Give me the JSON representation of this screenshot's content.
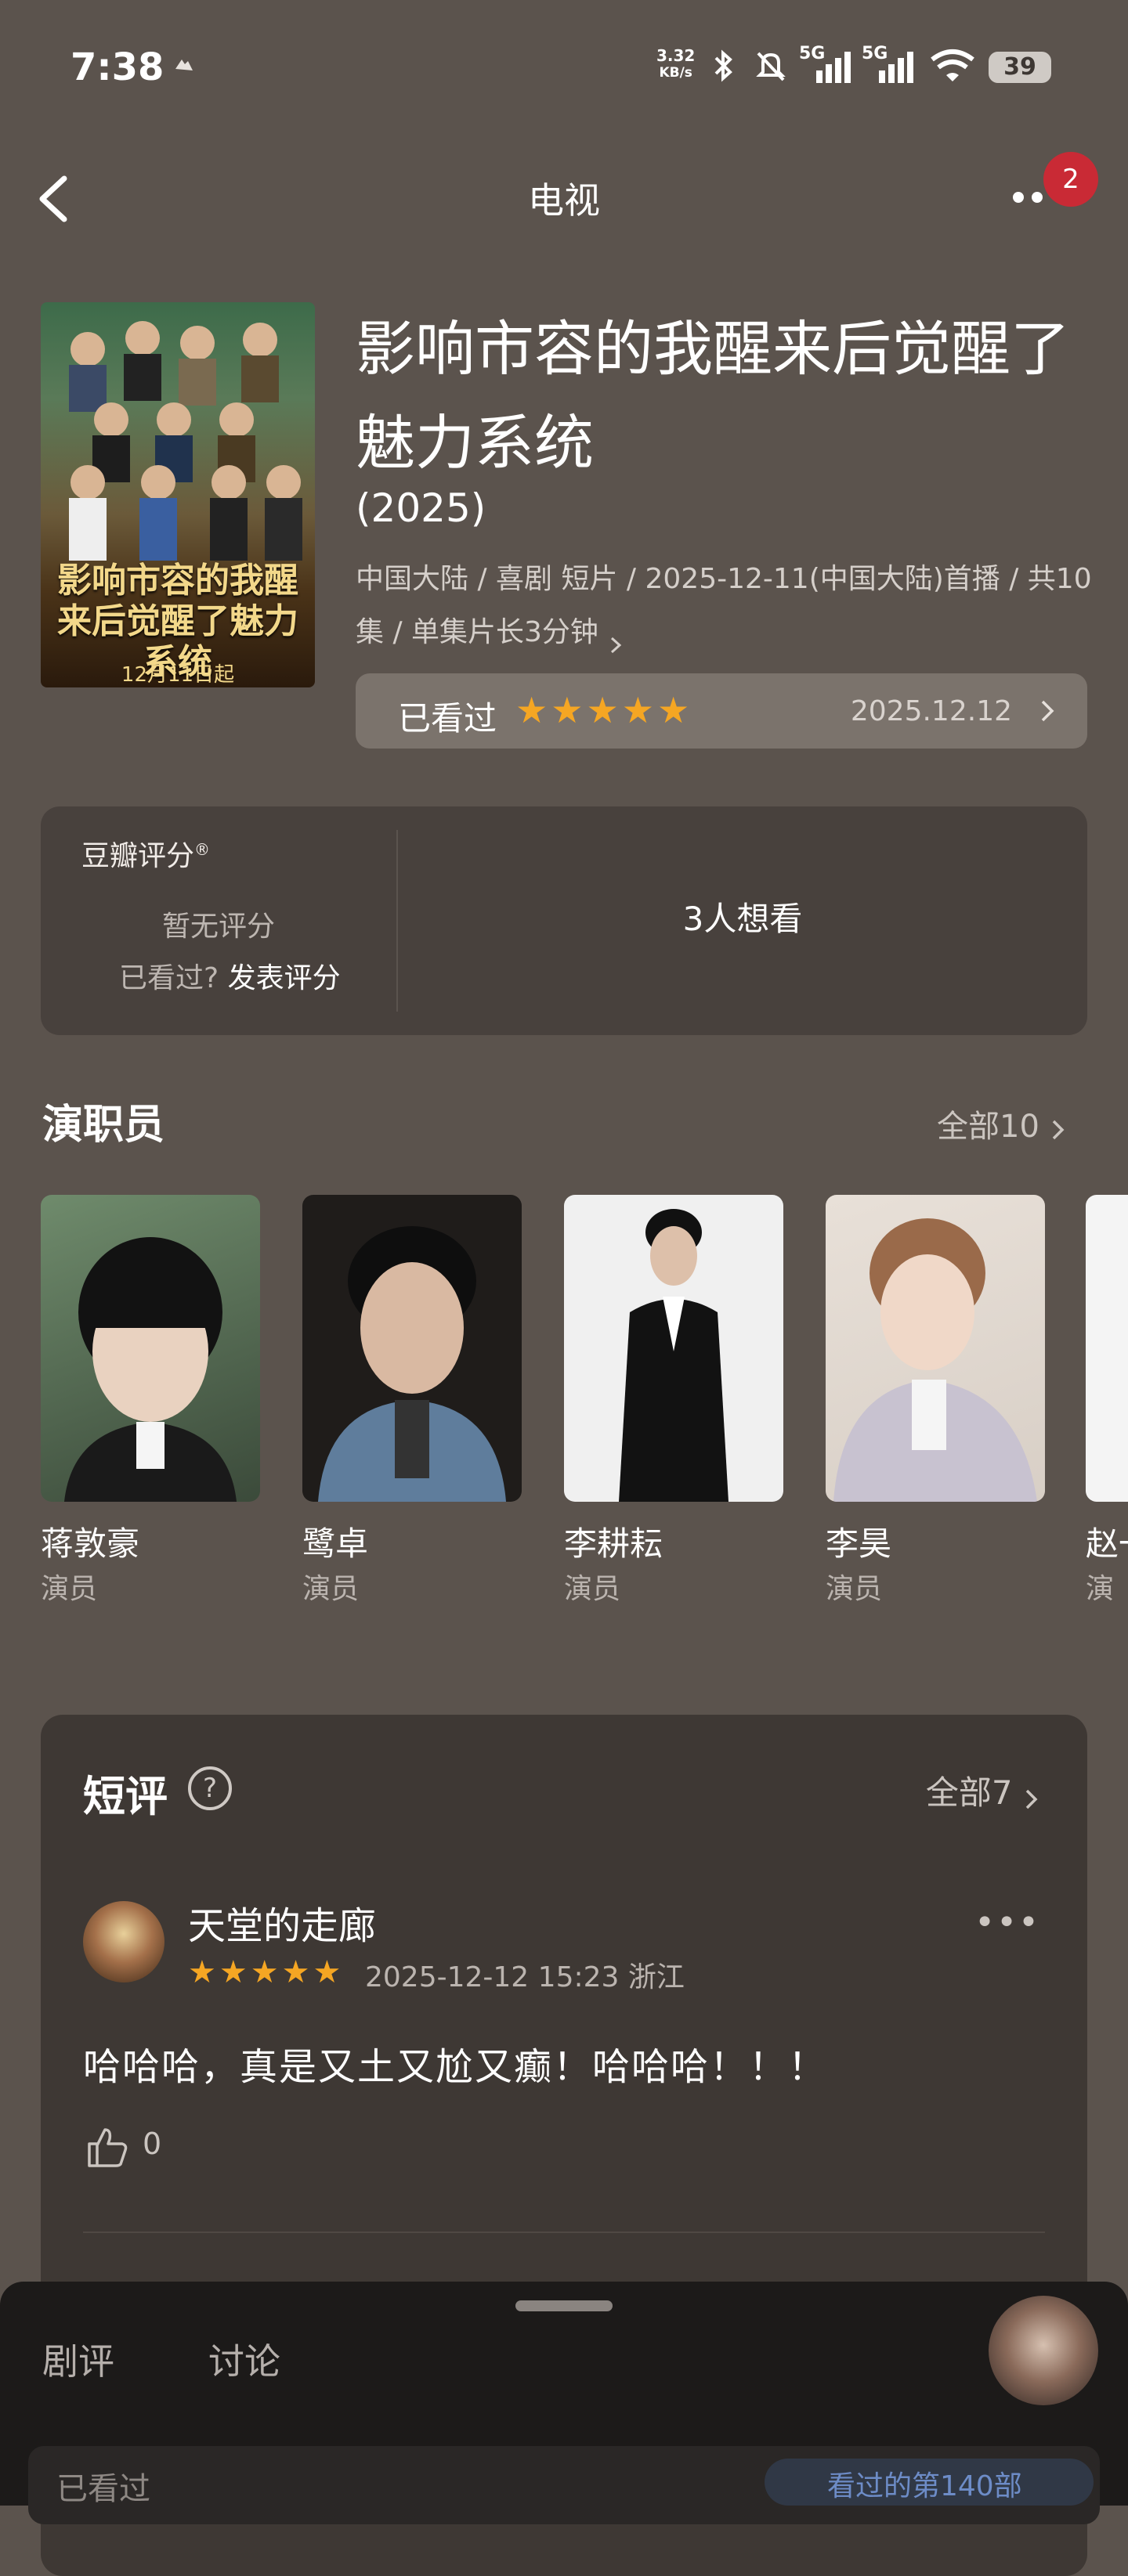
{
  "status_bar": {
    "time": "7:38",
    "net_speed_value": "3.32",
    "net_speed_unit": "KB/s",
    "sim1": "5G",
    "sim2": "5G",
    "battery": "39"
  },
  "header": {
    "title": "电视",
    "badge_count": "2"
  },
  "poster": {
    "title": "影响市容的我醒来后觉醒了魅力系统",
    "date": "12月11日起"
  },
  "work": {
    "title": "影响市容的我醒来后觉醒了魅力系统",
    "year": "(2025)",
    "meta": "中国大陆 / 喜剧 短片 / 2025-12-11(中国大陆)首播 / 共10集 / 单集片长3分钟",
    "watched_label": "已看过",
    "watched_stars": 5,
    "watched_date": "2025.12.12"
  },
  "rating": {
    "title": "豆瓣评分",
    "reg": "®",
    "no_rating": "暂无评分",
    "watched_q": "已看过?",
    "post_rating": "发表评分",
    "want_to_see": "3人想看"
  },
  "cast": {
    "title": "演职员",
    "all": "全部10",
    "members": [
      {
        "name": "蒋敦豪",
        "role": "演员"
      },
      {
        "name": "鹭卓",
        "role": "演员"
      },
      {
        "name": "李耕耘",
        "role": "演员"
      },
      {
        "name": "李昊",
        "role": "演员"
      },
      {
        "name": "赵一",
        "role": "演员"
      }
    ]
  },
  "short_reviews": {
    "title": "短评",
    "help": "?",
    "all": "全部7",
    "items": [
      {
        "user": "天堂的走廊",
        "stars": 5,
        "datetime": "2025-12-12 15:23 浙江",
        "text": "哈哈哈，真是又土又尬又癫！哈哈哈！！！",
        "likes": "0"
      }
    ]
  },
  "bottom_sheet": {
    "tabs": [
      "剧评",
      "讨论"
    ],
    "bar_left": "已看过",
    "bar_right": "看过的第140部"
  },
  "colors": {
    "background": "#5b534d",
    "star": "#f5a623",
    "badge": "#c92a35"
  }
}
